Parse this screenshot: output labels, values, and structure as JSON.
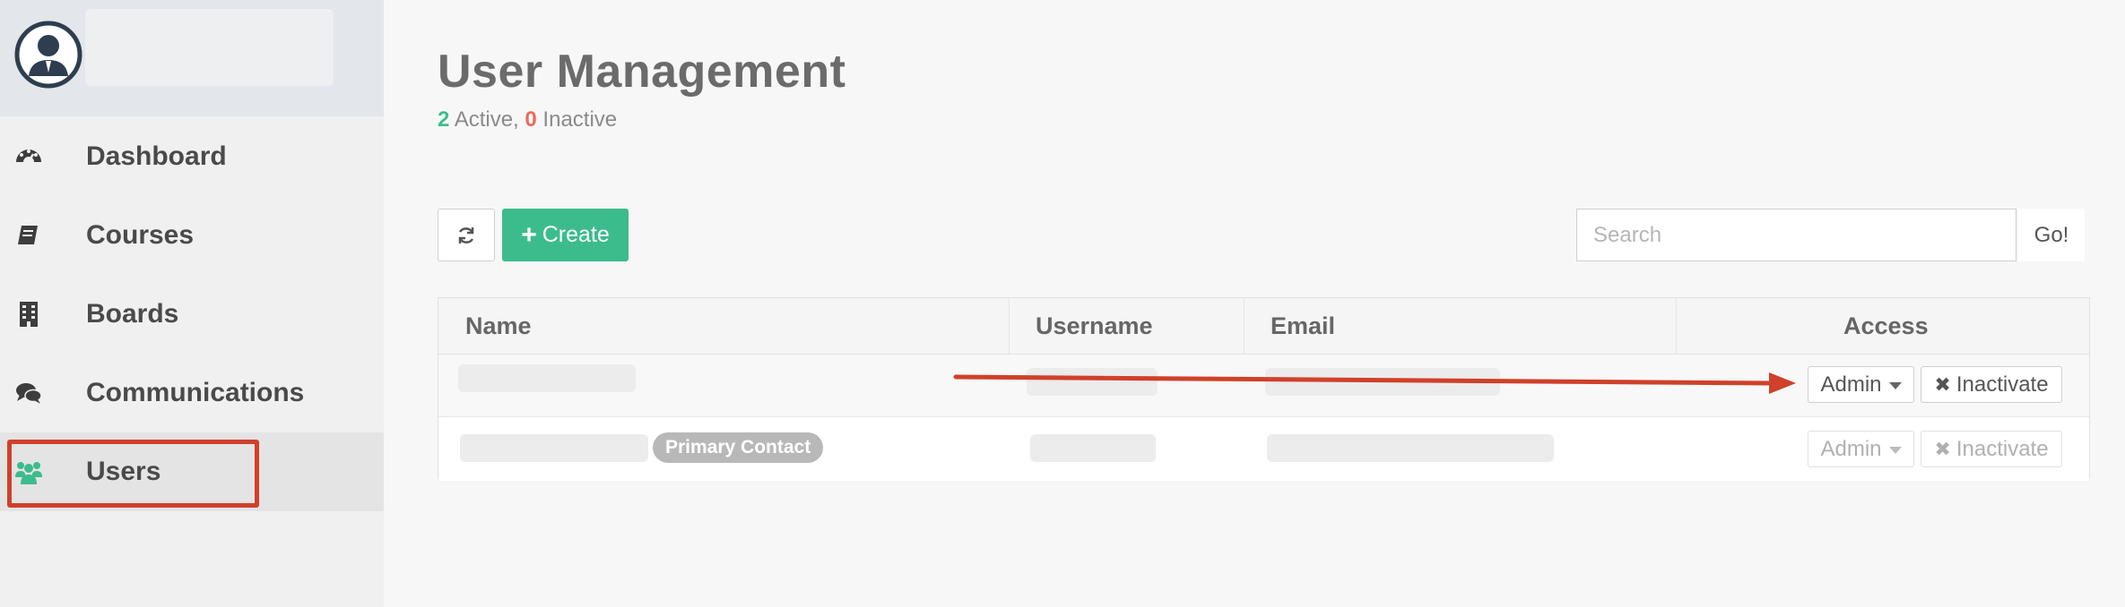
{
  "sidebar": {
    "items": [
      {
        "label": "Dashboard",
        "icon": "dashboard-icon"
      },
      {
        "label": "Courses",
        "icon": "book-icon"
      },
      {
        "label": "Boards",
        "icon": "building-icon"
      },
      {
        "label": "Communications",
        "icon": "comments-icon"
      },
      {
        "label": "Users",
        "icon": "users-icon",
        "active": true
      }
    ]
  },
  "header": {
    "title": "User Management",
    "active_count": "2",
    "active_label": " Active, ",
    "inactive_count": "0",
    "inactive_label": " Inactive"
  },
  "toolbar": {
    "create_label": "Create",
    "search_placeholder": "Search",
    "go_label": "Go!"
  },
  "table": {
    "columns": [
      "Name",
      "Username",
      "Email",
      "Access"
    ],
    "rows": [
      {
        "role": "Admin",
        "action": "Inactivate",
        "badge": "",
        "disabled": false
      },
      {
        "role": "Admin",
        "action": "Inactivate",
        "badge": "Primary Contact",
        "disabled": true
      }
    ]
  },
  "colors": {
    "accent": "#3cbc8d",
    "inactive": "#e86a5c",
    "annotation": "#d0402a"
  }
}
